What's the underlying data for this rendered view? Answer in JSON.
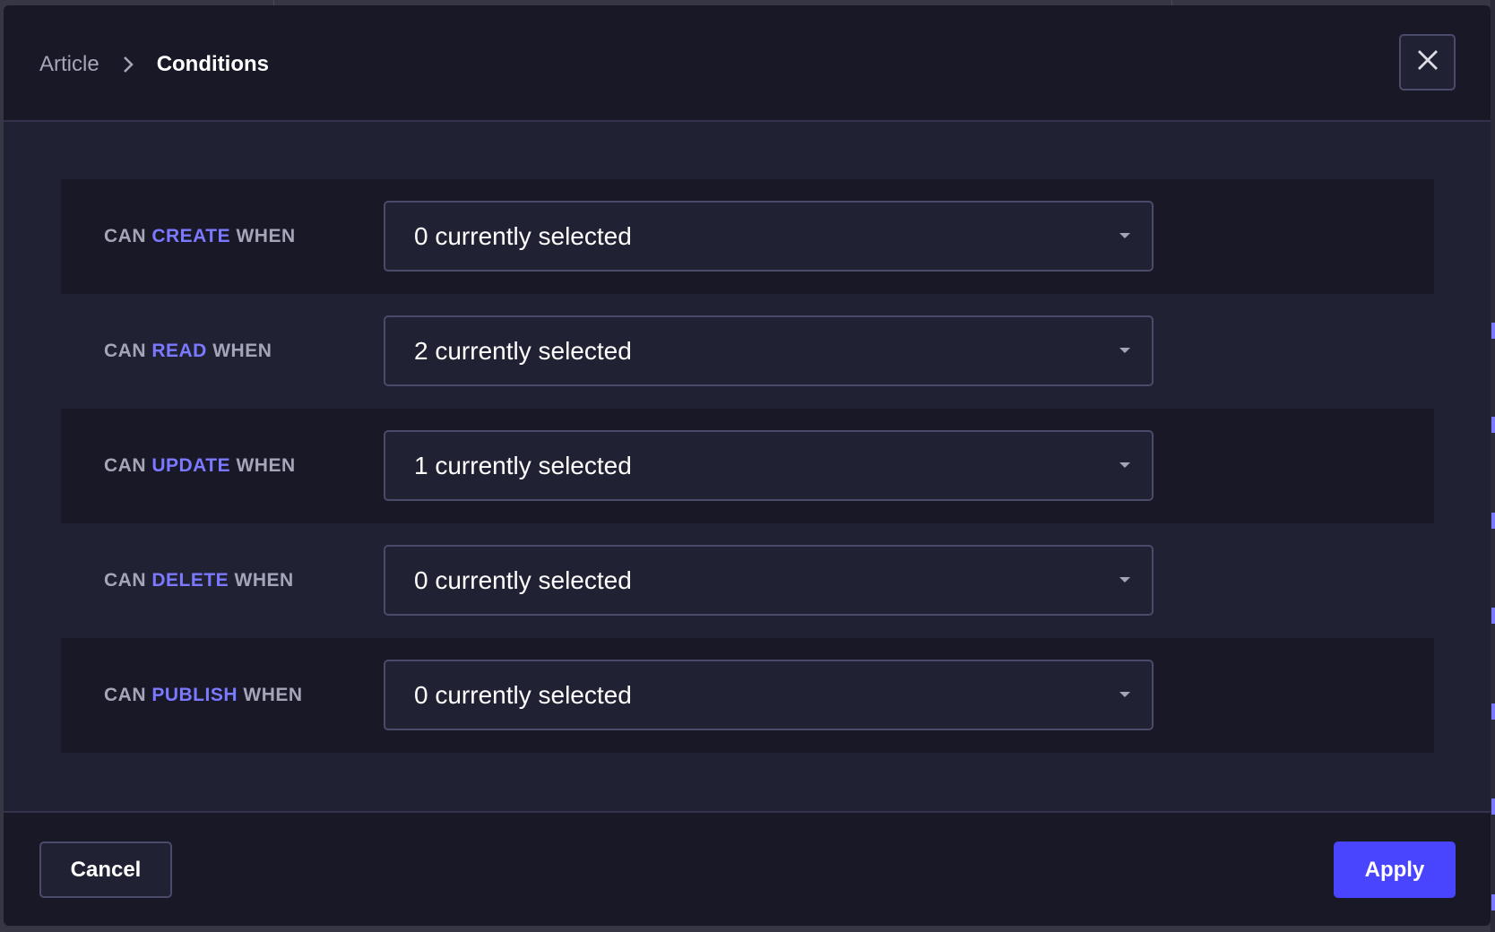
{
  "breadcrumb": {
    "parent": "Article",
    "current": "Conditions",
    "separator_icon": "chevron-right-icon"
  },
  "close_button": {
    "icon": "close-icon",
    "label": "Close"
  },
  "rows": [
    {
      "prefix": "CAN",
      "action": "CREATE",
      "suffix": "WHEN",
      "value": "0 currently selected"
    },
    {
      "prefix": "CAN",
      "action": "READ",
      "suffix": "WHEN",
      "value": "2 currently selected"
    },
    {
      "prefix": "CAN",
      "action": "UPDATE",
      "suffix": "WHEN",
      "value": "1 currently selected"
    },
    {
      "prefix": "CAN",
      "action": "DELETE",
      "suffix": "WHEN",
      "value": "0 currently selected"
    },
    {
      "prefix": "CAN",
      "action": "PUBLISH",
      "suffix": "WHEN",
      "value": "0 currently selected"
    }
  ],
  "footer": {
    "cancel_label": "Cancel",
    "apply_label": "Apply"
  },
  "colors": {
    "accent": "#7b79ff",
    "primary_button": "#4945ff",
    "surface": "#212134",
    "surface_alt": "#181826",
    "label": "#a5a5ba"
  }
}
